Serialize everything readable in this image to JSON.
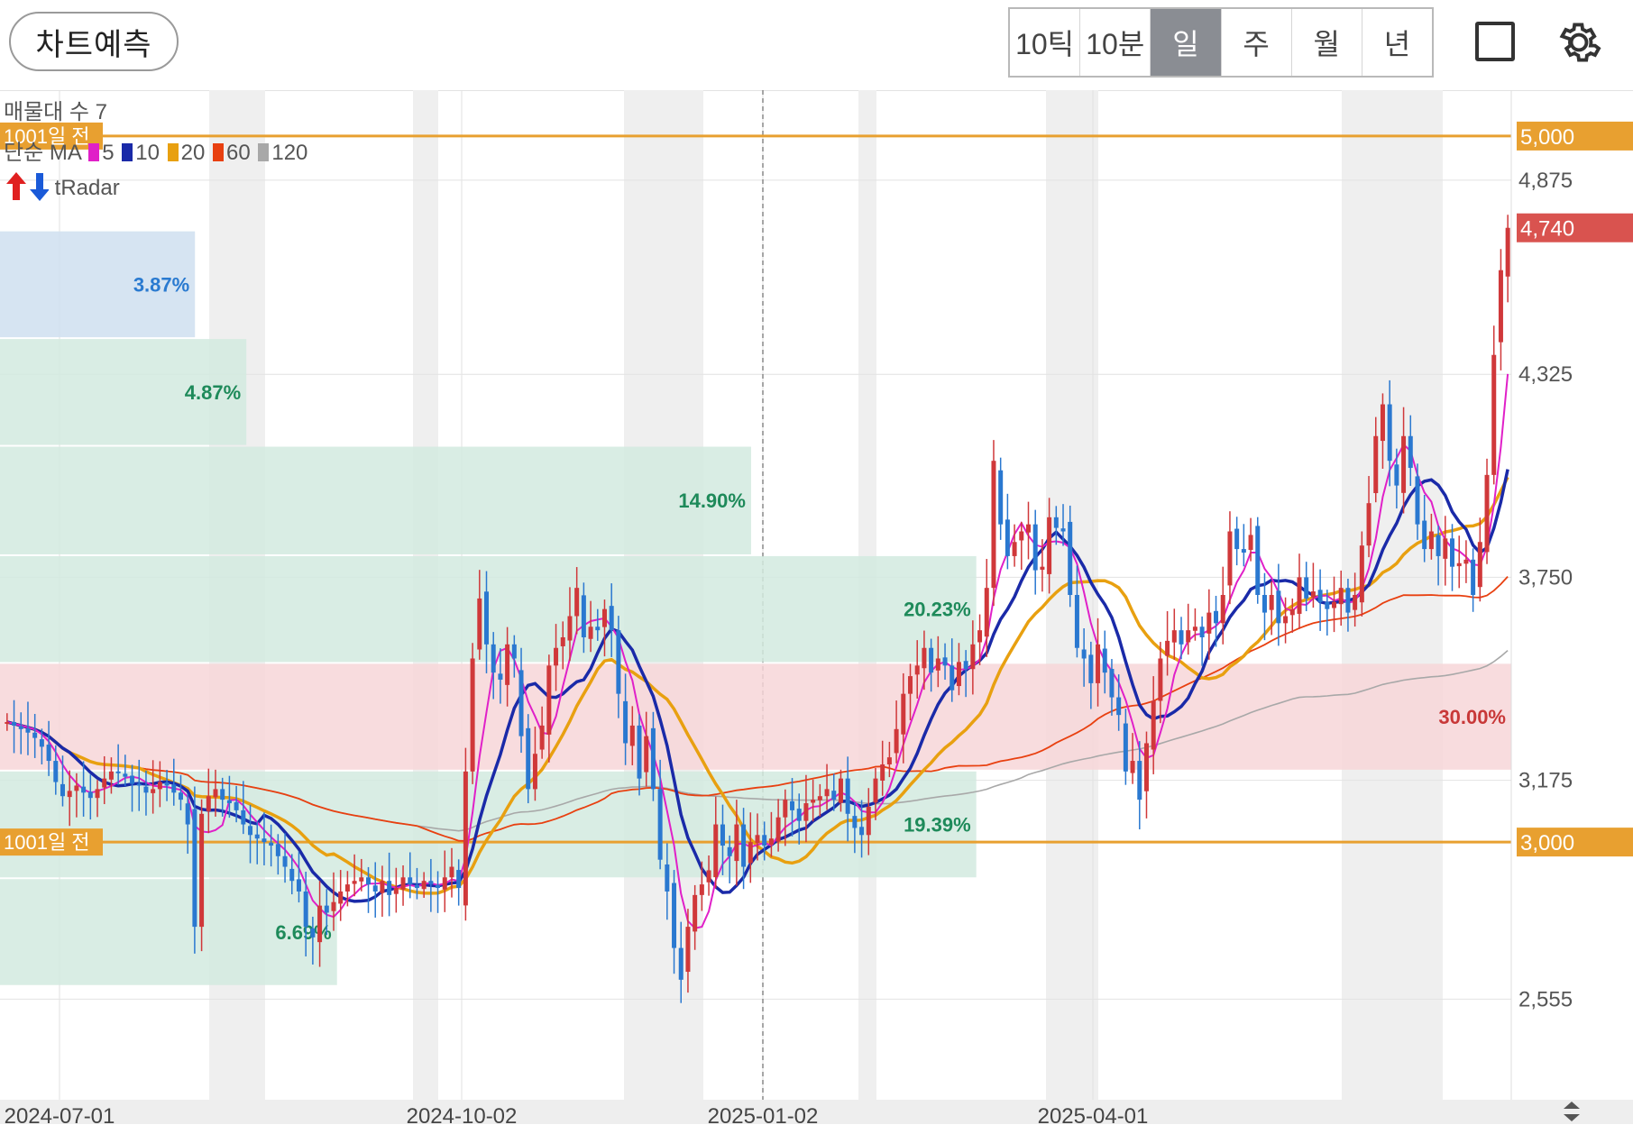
{
  "header": {
    "predict_button": "차트예측",
    "periods": [
      "10틱",
      "10분",
      "일",
      "주",
      "월",
      "년"
    ],
    "active_period": "일",
    "icons": [
      "fullscreen-square-icon",
      "gear-icon"
    ]
  },
  "legend": {
    "line1": "매물대 수 7",
    "ma_prefix": "단순 MA",
    "ma_items": [
      {
        "label": "5",
        "color": "#e020c8"
      },
      {
        "label": "10",
        "color": "#1a2aa8"
      },
      {
        "label": "20",
        "color": "#e8a010"
      },
      {
        "label": "60",
        "color": "#e84010"
      },
      {
        "label": "120",
        "color": "#a8a8a8"
      }
    ],
    "radar": "tRadar"
  },
  "colors": {
    "up": "#d0383a",
    "down": "#2a78d0",
    "ref_line": "#e8a030",
    "current_badge": "#d9534f",
    "grid": "#e2e2e2",
    "weekend_band": "#efefef"
  },
  "chart_data": {
    "type": "candlestick",
    "x_labels": [
      "2024-07-01",
      "2024-10-02",
      "2025-01-02",
      "2025-04-01"
    ],
    "y_ticks": [
      2555,
      3175,
      3750,
      4325,
      4875
    ],
    "y_range": [
      2270,
      5130
    ],
    "current_price": 4740,
    "current_price_label": "4,740",
    "ref_lines": [
      {
        "value": 5000,
        "label": "5,000",
        "tag": "1001일 전"
      },
      {
        "value": 3000,
        "label": "3,000",
        "tag": "1001일 전"
      }
    ],
    "volume_profile": [
      {
        "from": 4430,
        "to": 4730,
        "pct": "3.87%",
        "color": "blue",
        "length": 0.129
      },
      {
        "from": 4125,
        "to": 4425,
        "pct": "4.87%",
        "color": "green",
        "length": 0.163
      },
      {
        "from": 3815,
        "to": 4120,
        "pct": "14.90%",
        "color": "green",
        "length": 0.497
      },
      {
        "from": 3510,
        "to": 3810,
        "pct": "20.23%",
        "color": "green",
        "length": 0.646
      },
      {
        "from": 3205,
        "to": 3505,
        "pct": "30.00%",
        "color": "red",
        "length": 1.0
      },
      {
        "from": 2900,
        "to": 3200,
        "pct": "19.39%",
        "color": "green",
        "length": 0.646
      },
      {
        "from": 2595,
        "to": 2895,
        "pct": "6.69%",
        "color": "green",
        "length": 0.223
      }
    ],
    "close_series": [
      3340,
      3330,
      3320,
      3310,
      3295,
      3270,
      3230,
      3170,
      3130,
      3145,
      3160,
      3140,
      3125,
      3150,
      3180,
      3200,
      3195,
      3185,
      3165,
      3160,
      3140,
      3150,
      3170,
      3160,
      3140,
      3120,
      3050,
      2760,
      3080,
      3130,
      3150,
      3120,
      3110,
      3090,
      3050,
      3020,
      3010,
      3000,
      2990,
      2960,
      2930,
      2890,
      2860,
      2760,
      2730,
      2820,
      2800,
      2830,
      2860,
      2880,
      2890,
      2900,
      2880,
      2860,
      2890,
      2850,
      2870,
      2900,
      2880,
      2870,
      2890,
      2880,
      2870,
      2900,
      2930,
      2870,
      3200,
      3520,
      3690,
      3560,
      3480,
      3460,
      3560,
      3520,
      3300,
      3150,
      3250,
      3330,
      3500,
      3550,
      3580,
      3640,
      3720,
      3580,
      3610,
      3600,
      3660,
      3600,
      3420,
      3280,
      3330,
      3180,
      3300,
      3150,
      2950,
      2860,
      2700,
      2610,
      2760,
      2850,
      2880,
      2920,
      3050,
      2990,
      2960,
      3050,
      2930,
      3000,
      3020,
      2990,
      3010,
      3070,
      3120,
      3090,
      3060,
      3110,
      3120,
      3130,
      3150,
      3120,
      3180,
      3080,
      3040,
      3020,
      3100,
      3180,
      3220,
      3240,
      3320,
      3420,
      3470,
      3500,
      3550,
      3480,
      3520,
      3500,
      3430,
      3510,
      3490,
      3560,
      3600,
      3720,
      4080,
      3900,
      3810,
      3850,
      3880,
      3900,
      3770,
      3780,
      3920,
      3890,
      3880,
      3700,
      3550,
      3520,
      3450,
      3560,
      3480,
      3410,
      3360,
      3200,
      3230,
      3120,
      3280,
      3400,
      3520,
      3570,
      3600,
      3560,
      3600,
      3610,
      3580,
      3650,
      3620,
      3700,
      3880,
      3830,
      3820,
      3870,
      3700,
      3650,
      3700,
      3620,
      3640,
      3660,
      3750,
      3690,
      3710,
      3680,
      3660,
      3680,
      3720,
      3650,
      3700,
      3840,
      3960,
      4150,
      4240,
      4080,
      4010,
      4150,
      4060,
      3900,
      3830,
      3880,
      3810,
      3860,
      3780,
      3790,
      3800,
      3700,
      3850,
      4040,
      4380,
      4620,
      4740
    ]
  }
}
